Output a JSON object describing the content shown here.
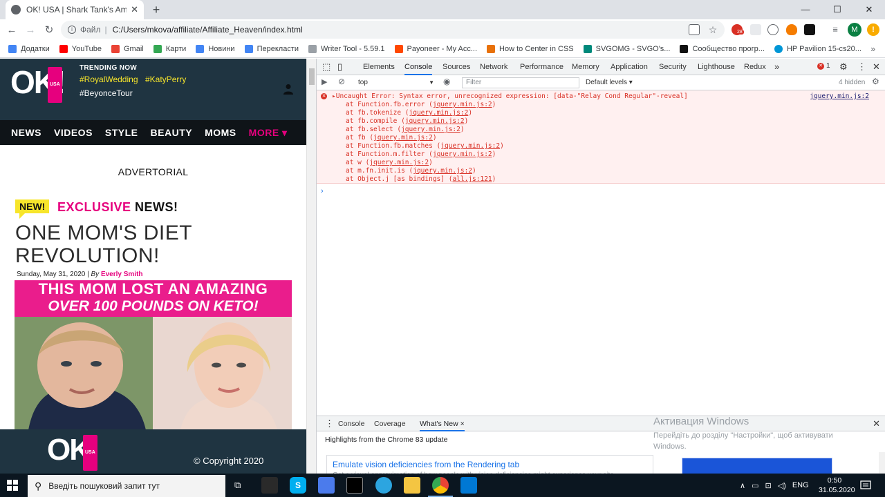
{
  "browser": {
    "tab_title": "OK! USA | Shark Tank's Amazing",
    "new_tab": "+",
    "url_scheme": "Файл",
    "url": "C:/Users/mkova/affiliate/Affiliate_Heaven/index.html",
    "profile_initial": "M",
    "ext_badge": "28"
  },
  "bookmarks": [
    {
      "label": "Додатки",
      "color": "#4285f4"
    },
    {
      "label": "YouTube",
      "color": "#ff0000"
    },
    {
      "label": "Gmail",
      "color": "#ea4335"
    },
    {
      "label": "Карти",
      "color": "#34a853"
    },
    {
      "label": "Новини",
      "color": "#4285f4"
    },
    {
      "label": "Перекласти",
      "color": "#4285f4"
    },
    {
      "label": "Writer Tool - 5.59.1",
      "color": "#9aa0a6"
    },
    {
      "label": "Payoneer - My Acc...",
      "color": "#ff4800"
    },
    {
      "label": "How to Center in CSS",
      "color": "#e8710a"
    },
    {
      "label": "SVGOMG - SVGO's...",
      "color": "#00897b"
    },
    {
      "label": "Сообщество прогр...",
      "color": "#111111"
    },
    {
      "label": "HP Pavilion 15-cs20...",
      "color": "#0096d6"
    }
  ],
  "site": {
    "logo_text": "OK!",
    "logo_badge": "USA",
    "trending_label": "TRENDING NOW",
    "trending": [
      "#RoyalWedding",
      "#KatyPerry",
      "#BeyonceTour"
    ],
    "nav": [
      "NEWS",
      "VIDEOS",
      "STYLE",
      "BEAUTY",
      "MOMS",
      "MORE ▾"
    ],
    "advertorial": "ADVERTORIAL",
    "new_badge": "NEW!",
    "exclusive_pink": "EXCLUSIVE",
    "exclusive_dark": "NEWS!",
    "headline_1": "ONE MOM'S DIET",
    "headline_2": "REVOLUTION!",
    "byline_date": "Sunday, May 31, 2020 | ",
    "byline_by": "By ",
    "byline_author": "Everly Smith",
    "banner_line1": "THIS MOM LOST AN AMAZING",
    "banner_line2": "OVER 100 POUNDS ON KETO!",
    "copyright": "© Copyright 2020"
  },
  "devtools": {
    "tabs": [
      "Elements",
      "Console",
      "Sources",
      "Network",
      "Performance",
      "Memory",
      "Application",
      "Security",
      "Lighthouse",
      "Redux"
    ],
    "overflow": "»",
    "error_count": "1",
    "context": "top",
    "filter_placeholder": "Filter",
    "levels": "Default levels ▾",
    "hidden": "4 hidden",
    "error": {
      "message": "▸Uncaught Error: Syntax error, unrecognized expression: [data-\"Relay Cond Regular\"-reveal]",
      "source": "jquery.min.js:2",
      "stack": [
        {
          "fn": "at Function.fb.error (",
          "link": "jquery.min.js:2",
          "end": ")"
        },
        {
          "fn": "at fb.tokenize (",
          "link": "jquery.min.js:2",
          "end": ")"
        },
        {
          "fn": "at fb.compile (",
          "link": "jquery.min.js:2",
          "end": ")"
        },
        {
          "fn": "at fb.select (",
          "link": "jquery.min.js:2",
          "end": ")"
        },
        {
          "fn": "at fb (",
          "link": "jquery.min.js:2",
          "end": ")"
        },
        {
          "fn": "at Function.fb.matches (",
          "link": "jquery.min.js:2",
          "end": ")"
        },
        {
          "fn": "at Function.m.filter (",
          "link": "jquery.min.js:2",
          "end": ")"
        },
        {
          "fn": "at w (",
          "link": "jquery.min.js:2",
          "end": ")"
        },
        {
          "fn": "at m.fn.init.is (",
          "link": "jquery.min.js:2",
          "end": ")"
        },
        {
          "fn": "at Object.j [as bindings] (",
          "link": "all.js:121",
          "end": ")"
        }
      ]
    },
    "prompt": "›",
    "drawer_tabs": [
      "Console",
      "Coverage",
      "What's New ×"
    ],
    "drawer_subtitle": "Highlights from the Chrome 83 update",
    "whats_new_title": "Emulate vision deficiencies from the Rendering tab",
    "whats_new_desc": "Get a visual approximation of how people with vision deficiencies might experience your site."
  },
  "windows_activation": {
    "title": "Активация Windows",
    "text": "Перейдіть до розділу \"Настройки\", щоб активувати Windows."
  },
  "taskbar": {
    "search_placeholder": "Введіть пошуковий запит тут",
    "lang": "ENG",
    "time": "0:50",
    "date": "31.05.2020"
  }
}
